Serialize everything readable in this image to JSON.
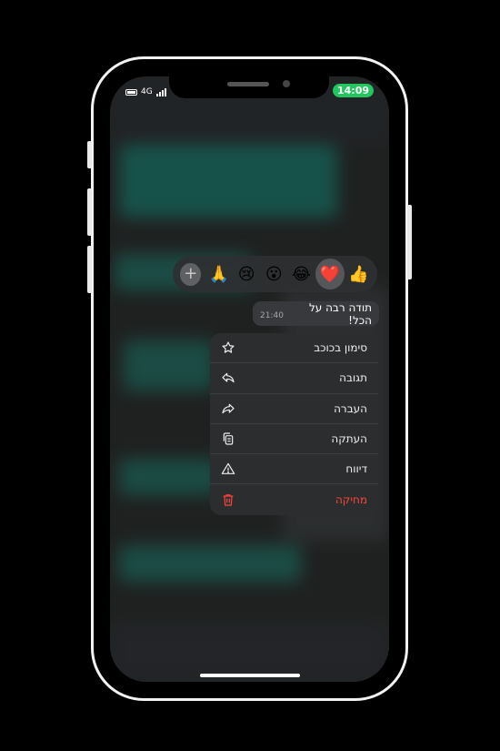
{
  "status_bar": {
    "network": "4G",
    "time": "14:09"
  },
  "reactions": {
    "add_label": "+",
    "items": [
      {
        "emoji": "🙏",
        "name": "folded-hands"
      },
      {
        "emoji": "😢",
        "name": "crying-face"
      },
      {
        "emoji": "😮",
        "name": "surprised-face"
      },
      {
        "emoji": "😂",
        "name": "laughing-face"
      },
      {
        "emoji": "❤️",
        "name": "red-heart",
        "selected": true
      },
      {
        "emoji": "👍",
        "name": "thumbs-up"
      }
    ]
  },
  "message": {
    "text": "תודה רבה על הכל!",
    "time": "21:40"
  },
  "context_menu": {
    "star": "סימון בכוכב",
    "reply": "תגובה",
    "forward": "העברה",
    "copy": "העתקה",
    "report": "דיווח",
    "delete": "מחיקה"
  },
  "colors": {
    "accent": "#22c55e",
    "danger": "#ff453a",
    "menu_bg": "#2c2d30"
  }
}
